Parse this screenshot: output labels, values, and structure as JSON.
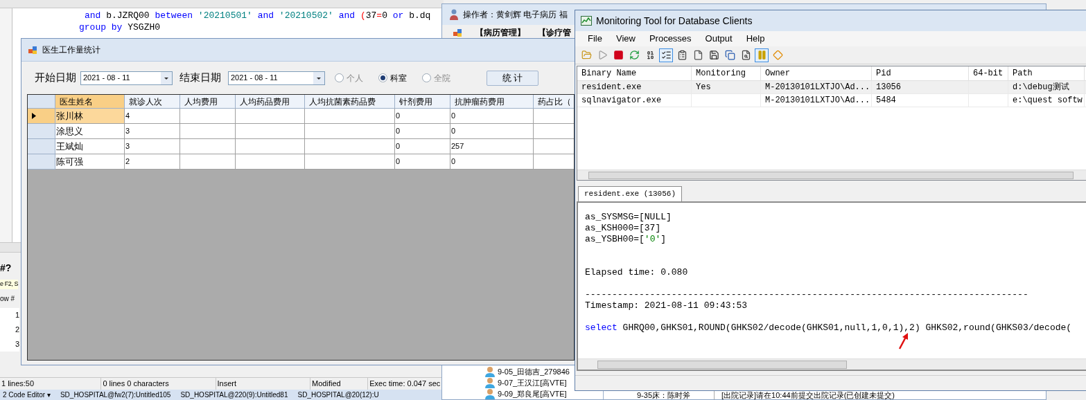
{
  "sql_editor": {
    "lines": [
      [
        {
          "text": "and",
          "kind": "keyword"
        },
        {
          "text": " b.JZRQ00 ",
          "kind": "plain"
        },
        {
          "text": "between",
          "kind": "keyword"
        },
        {
          "text": " '20210501' ",
          "kind": "string"
        },
        {
          "text": "and",
          "kind": "keyword"
        },
        {
          "text": " '20210502' ",
          "kind": "string"
        },
        {
          "text": "and",
          "kind": "keyword"
        },
        {
          "text": " (",
          "kind": "operator"
        },
        {
          "text": "37",
          "kind": "plain"
        },
        {
          "text": "=",
          "kind": "operator"
        },
        {
          "text": "0 ",
          "kind": "plain"
        },
        {
          "text": "or",
          "kind": "keyword"
        },
        {
          "text": " b.dq",
          "kind": "plain"
        }
      ],
      [
        {
          "text": "group by",
          "kind": "keyword"
        },
        {
          "text": " YSGZH0",
          "kind": "plain"
        }
      ]
    ],
    "side_labels": [
      {
        "text": "#?",
        "kind": "heading"
      },
      {
        "text": "e F2, S",
        "kind": "hint"
      },
      {
        "text": "ow #",
        "kind": "header"
      }
    ],
    "row_numbers": [
      "1",
      "2",
      "3"
    ],
    "status_bar": [
      "1 lines:50",
      "0 lines 0 characters",
      "Insert",
      "Modified",
      "Exec time: 0.047 sec"
    ],
    "taskbar": [
      "2 Code Editor ▾",
      "SD_HOSPITAL@fw2(7):Untitled105",
      "SD_HOSPITAL@220(9):Untitled81",
      "SD_HOSPITAL@20(12):U"
    ]
  },
  "emr_window": {
    "title": "操作者：黄剑辉 电子病历 福",
    "menu": [
      "【病历管理】",
      "【诊疗管"
    ],
    "tree_items": [
      "9-05_田德吉_279846",
      "9-07_王汉江[高VTE]",
      "9-09_郑良尾[高VTE]"
    ],
    "bottom_row": [
      "9-35床：陈时斧",
      "[出院记录]请在10:44前提交出院记录(已创建未提交)"
    ]
  },
  "stats_dialog": {
    "title": "医生工作量统计",
    "start_label": "开始日期",
    "start_date": "2021 - 08 - 11",
    "end_label": "结束日期",
    "end_date": "2021 - 08 - 11",
    "scopes": [
      {
        "label": "个人",
        "selected": false
      },
      {
        "label": "科室",
        "selected": true
      },
      {
        "label": "全院",
        "selected": false
      }
    ],
    "button": "统 计",
    "columns": [
      "医生姓名",
      "就诊人次",
      "人均费用",
      "人均药品费用",
      "人均抗菌素药品费",
      "针剂费用",
      "抗肿瘤药费用",
      "药占比（"
    ],
    "rows": [
      {
        "name": "张川林",
        "visits": "4",
        "injection_fee": "0",
        "antitumor_fee": "0",
        "selected": true
      },
      {
        "name": "涂思义",
        "visits": "3",
        "injection_fee": "0",
        "antitumor_fee": "0",
        "selected": false
      },
      {
        "name": "王斌灿",
        "visits": "3",
        "injection_fee": "0",
        "antitumor_fee": "257",
        "selected": false
      },
      {
        "name": "陈可强",
        "visits": "2",
        "injection_fee": "0",
        "antitumor_fee": "0",
        "selected": false
      }
    ]
  },
  "monitor": {
    "title": "Monitoring Tool for Database Clients",
    "menu": [
      "File",
      "View",
      "Processes",
      "Output",
      "Help"
    ],
    "columns": [
      "Binary Name",
      "Monitoring",
      "Owner",
      "Pid",
      "64-bit",
      "Path"
    ],
    "rows": [
      {
        "binary_name": "resident.exe",
        "monitoring": "Yes",
        "owner": "M-20130101LXTJO\\Ad...",
        "pid": "13056",
        "path": "d:\\debug测试",
        "selected": true
      },
      {
        "binary_name": "sqlnavigator.exe",
        "owner": "M-20130101LXTJO\\Ad...",
        "pid": "5484",
        "path": "e:\\quest softw",
        "selected": false
      }
    ],
    "tab": "resident.exe (13056)",
    "log": [
      {
        "kind": "param",
        "tokens": [
          {
            "text": "as_SYSMSG=[NULL]",
            "kind": "plain"
          }
        ]
      },
      {
        "kind": "param",
        "tokens": [
          {
            "text": "as_KSH000=[37]",
            "kind": "plain"
          }
        ]
      },
      {
        "kind": "param",
        "tokens": [
          {
            "text": "as_YSBH00=[",
            "kind": "plain"
          },
          {
            "text": "'0'",
            "kind": "string"
          },
          {
            "text": "]",
            "kind": "plain"
          }
        ]
      },
      {
        "kind": "elapsed",
        "tokens": [
          {
            "text": "Elapsed time: 0.080",
            "kind": "plain"
          }
        ]
      },
      {
        "kind": "separator",
        "tokens": [
          {
            "text": "----------------------------------------------------------------------------------",
            "kind": "plain"
          }
        ]
      },
      {
        "kind": "timestamp",
        "tokens": [
          {
            "text": "Timestamp: 2021-08-11 09:43:53",
            "kind": "plain"
          }
        ]
      },
      {
        "kind": "sql",
        "tokens": [
          {
            "text": "select",
            "kind": "keyword"
          },
          {
            "text": " GHRQ00,GHKS01,ROUND(GHKS02/decode(GHKS01,null,1,0,1),2) GHKS02,round(GHKS03/decode(",
            "kind": "plain"
          }
        ]
      }
    ]
  }
}
